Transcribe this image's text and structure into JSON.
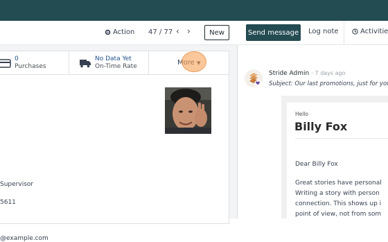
{
  "form": {
    "action_label": "Action",
    "pager": "47 / 77",
    "new_label": "New",
    "stats": [
      {
        "value": "0",
        "label": "Purchases",
        "icon": "credit-card-icon"
      },
      {
        "value": "No Data Yet",
        "label": "On-Time Rate",
        "icon": "truck-icon"
      }
    ],
    "more_label": "More",
    "fields": [
      "Supervisor",
      "5611",
      "@example.com"
    ]
  },
  "chatter": {
    "send_message": "Send message",
    "log_note": "Log note",
    "activities": "Activities",
    "author": "Stride Admin",
    "when": "- 7 days ago",
    "subject": "Subject: Our last promotions, just for you",
    "email": {
      "hello": "Hello",
      "name": "Billy Fox",
      "greeting": "Dear Billy Fox",
      "lines": [
        "Great stories have personal",
        "Writing a story with person",
        "connection. This shows up i",
        "point of view, not from som"
      ]
    }
  },
  "colors": {
    "topbar": "#234b52",
    "primary_button": "#234b52",
    "stat_value": "#1f4f8a",
    "highlight": "#f6a256"
  }
}
